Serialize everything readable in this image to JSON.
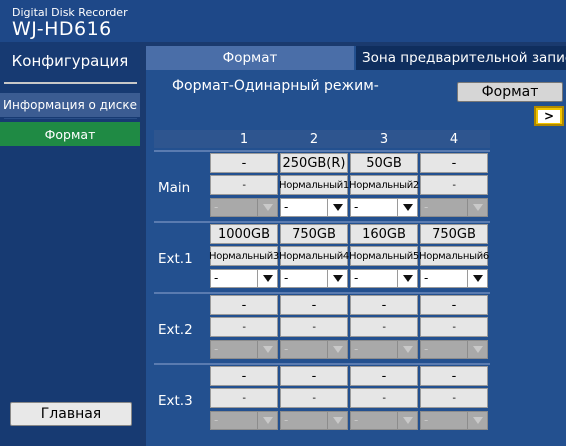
{
  "brand": {
    "line1": "Digital Disk Recorder",
    "line2": "WJ-HD616"
  },
  "sidebar": {
    "title": "Конфигурация",
    "items": [
      {
        "label": "Информация о диске",
        "active": false
      },
      {
        "label": "Формат",
        "active": true
      }
    ],
    "home_button": "Главная"
  },
  "tabs": [
    {
      "label": "Формат",
      "active": true
    },
    {
      "label": "Зона предварительной записи",
      "active": false
    }
  ],
  "main": {
    "heading": "Формат-Одинарный режим-",
    "format_button": "Формат",
    "next_button": ">"
  },
  "grid": {
    "columns": [
      "1",
      "2",
      "3",
      "4"
    ],
    "rows": [
      {
        "label": "Main",
        "capacity": [
          "-",
          "250GB(R)",
          "50GB",
          "-"
        ],
        "name": [
          "-",
          "Нормальный1",
          "Нормальный2",
          "-"
        ],
        "select": [
          {
            "value": "-",
            "enabled": false
          },
          {
            "value": "-",
            "enabled": true
          },
          {
            "value": "-",
            "enabled": true
          },
          {
            "value": "-",
            "enabled": false
          }
        ]
      },
      {
        "label": "Ext.1",
        "capacity": [
          "1000GB",
          "750GB",
          "160GB",
          "750GB"
        ],
        "name": [
          "Нормальный3",
          "Нормальный4",
          "Нормальный5",
          "Нормальный6"
        ],
        "select": [
          {
            "value": "-",
            "enabled": true
          },
          {
            "value": "-",
            "enabled": true
          },
          {
            "value": "-",
            "enabled": true
          },
          {
            "value": "-",
            "enabled": true
          }
        ]
      },
      {
        "label": "Ext.2",
        "capacity": [
          "-",
          "-",
          "-",
          "-"
        ],
        "name": [
          "-",
          "-",
          "-",
          "-"
        ],
        "select": [
          {
            "value": "-",
            "enabled": false
          },
          {
            "value": "-",
            "enabled": false
          },
          {
            "value": "-",
            "enabled": false
          },
          {
            "value": "-",
            "enabled": false
          }
        ]
      },
      {
        "label": "Ext.3",
        "capacity": [
          "-",
          "-",
          "-",
          "-"
        ],
        "name": [
          "-",
          "-",
          "-",
          "-"
        ],
        "select": [
          {
            "value": "-",
            "enabled": false
          },
          {
            "value": "-",
            "enabled": false
          },
          {
            "value": "-",
            "enabled": false
          },
          {
            "value": "-",
            "enabled": false
          }
        ]
      }
    ]
  }
}
